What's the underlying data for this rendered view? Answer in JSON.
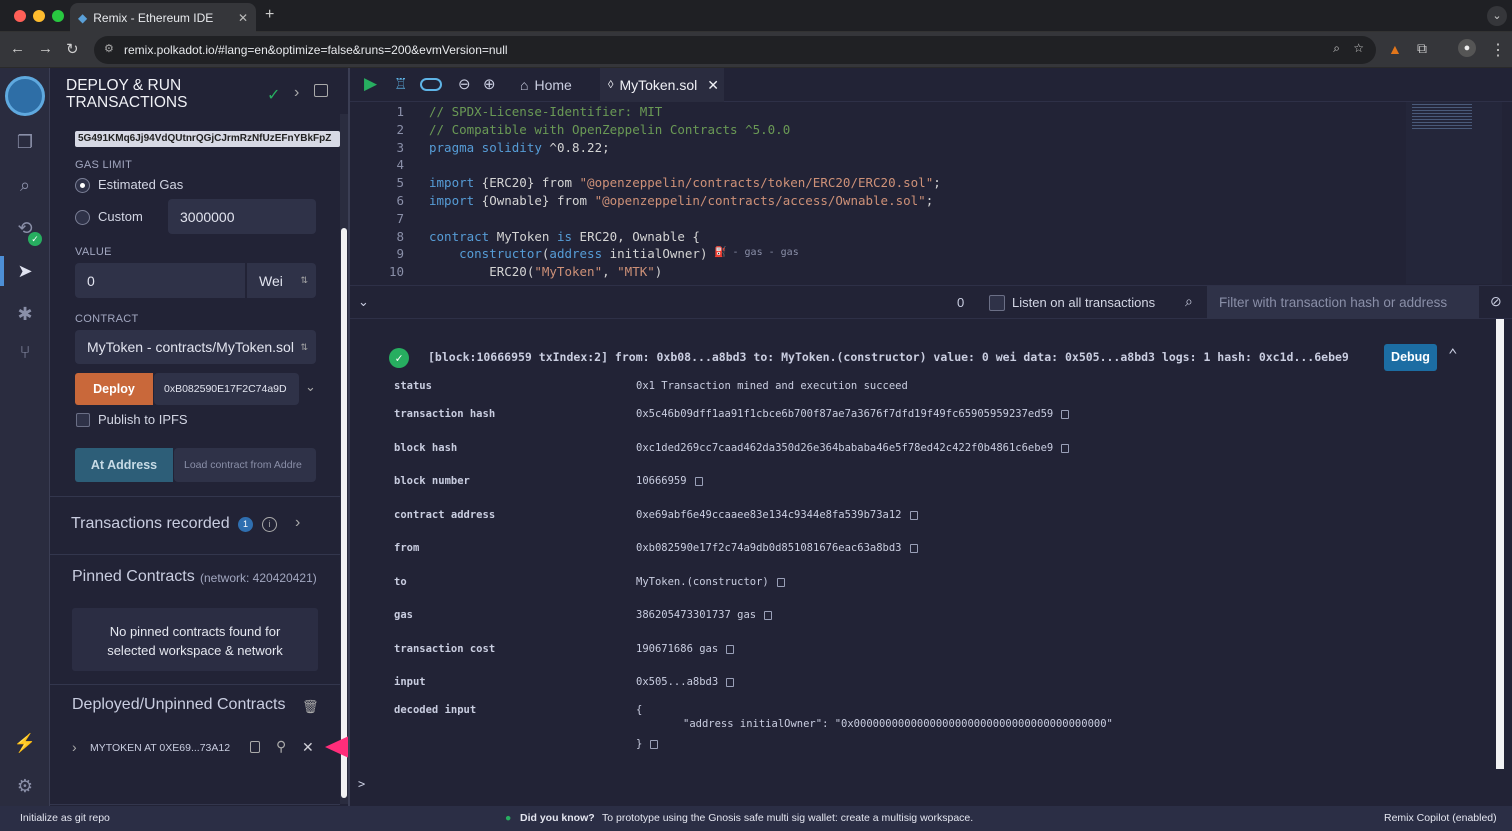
{
  "browser": {
    "tab_title": "Remix - Ethereum IDE",
    "url": "remix.polkadot.io/#lang=en&optimize=false&runs=200&evmVersion=null"
  },
  "panel": {
    "title_line1": "DEPLOY & RUN",
    "title_line2": "TRANSACTIONS",
    "account_partial": "5G491KMq6Jj94VdQUtnrQGjCJrmRzNfUzEFnYBkFpZ",
    "gas_limit_label": "GAS LIMIT",
    "estimated_gas_label": "Estimated Gas",
    "custom_label": "Custom",
    "custom_gas_value": "3000000",
    "value_label": "VALUE",
    "value_amount": "0",
    "value_unit": "Wei",
    "contract_label": "CONTRACT",
    "contract_selected": "MyToken - contracts/MyToken.sol",
    "deploy_label": "Deploy",
    "deploy_arg": "0xB082590E17F2C74a9D",
    "publish_ipfs_label": "Publish to IPFS",
    "at_address_label": "At Address",
    "at_address_placeholder": "Load contract from Addre",
    "tx_recorded_label": "Transactions recorded",
    "tx_recorded_count": "1",
    "pinned_title": "Pinned Contracts",
    "pinned_network": "(network: 420420421)",
    "pinned_empty_line1": "No pinned contracts found for",
    "pinned_empty_line2": "selected workspace & network",
    "deployed_title": "Deployed/Unpinned Contracts",
    "deployed_item": "MYTOKEN AT 0XE69...73A12"
  },
  "editor": {
    "home_tab": "Home",
    "file_tab": "MyToken.sol",
    "lines": [
      {
        "n": "1",
        "segments": [
          {
            "t": "// SPDX-License-Identifier: MIT",
            "c": "cm"
          }
        ]
      },
      {
        "n": "2",
        "segments": [
          {
            "t": "// Compatible with OpenZeppelin Contracts ^5.0.0",
            "c": "cm"
          }
        ]
      },
      {
        "n": "3",
        "segments": [
          {
            "t": "pragma solidity",
            "c": "kw"
          },
          {
            "t": " ^0.8.22;",
            "c": ""
          }
        ]
      },
      {
        "n": "4",
        "segments": []
      },
      {
        "n": "5",
        "segments": [
          {
            "t": "import",
            "c": "kw"
          },
          {
            "t": " {ERC20} from ",
            "c": ""
          },
          {
            "t": "\"@openzeppelin/contracts/token/ERC20/ERC20.sol\"",
            "c": "st"
          },
          {
            "t": ";",
            "c": ""
          }
        ]
      },
      {
        "n": "6",
        "segments": [
          {
            "t": "import",
            "c": "kw"
          },
          {
            "t": " {Ownable} from ",
            "c": ""
          },
          {
            "t": "\"@openzeppelin/contracts/access/Ownable.sol\"",
            "c": "st"
          },
          {
            "t": ";",
            "c": ""
          }
        ]
      },
      {
        "n": "7",
        "segments": []
      },
      {
        "n": "8",
        "segments": [
          {
            "t": "contract",
            "c": "kw"
          },
          {
            "t": " MyToken ",
            "c": ""
          },
          {
            "t": "is",
            "c": "kw"
          },
          {
            "t": " ERC20, Ownable {",
            "c": ""
          }
        ]
      },
      {
        "n": "9",
        "segments": [
          {
            "t": "    constructor",
            "c": "kw"
          },
          {
            "t": "(",
            "c": ""
          },
          {
            "t": "address",
            "c": "kw"
          },
          {
            "t": " initialOwner)",
            "c": ""
          }
        ]
      },
      {
        "n": "10",
        "segments": [
          {
            "t": "        ERC20(",
            "c": ""
          },
          {
            "t": "\"MyToken\"",
            "c": "st"
          },
          {
            "t": ", ",
            "c": ""
          },
          {
            "t": "\"MTK\"",
            "c": "st"
          },
          {
            "t": ")",
            "c": ""
          }
        ]
      }
    ],
    "gas_hint": "- gas - gas"
  },
  "terminal": {
    "pending_count": "0",
    "listen_label": "Listen on all transactions",
    "filter_placeholder": "Filter with transaction hash or address",
    "summary": "[block:10666959 txIndex:2] from: 0xb08...a8bd3 to: MyToken.(constructor) value: 0 wei data: 0x505...a8bd3 logs: 1 hash: 0xc1d...6ebe9",
    "debug_label": "Debug",
    "rows": [
      {
        "key": "status",
        "value": "0x1 Transaction mined and execution succeed",
        "copy": false
      },
      {
        "key": "transaction hash",
        "value": "0x5c46b09dff1aa91f1cbce6b700f87ae7a3676f7dfd19f49fc65905959237ed59",
        "copy": true
      },
      {
        "key": "block hash",
        "value": "0xc1ded269cc7caad462da350d26e364bababa46e5f78ed42c422f0b4861c6ebe9",
        "copy": true
      },
      {
        "key": "block number",
        "value": "10666959",
        "copy": true
      },
      {
        "key": "contract address",
        "value": "0xe69abf6e49ccaaee83e134c9344e8fa539b73a12",
        "copy": true
      },
      {
        "key": "from",
        "value": "0xb082590e17f2c74a9db0d851081676eac63a8bd3",
        "copy": true
      },
      {
        "key": "to",
        "value": "MyToken.(constructor)",
        "copy": true
      },
      {
        "key": "gas",
        "value": "386205473301737 gas",
        "copy": true
      },
      {
        "key": "transaction cost",
        "value": "190671686 gas",
        "copy": true
      },
      {
        "key": "input",
        "value": "0x505...a8bd3",
        "copy": true
      }
    ],
    "decoded_key": "decoded input",
    "decoded_open": "{",
    "decoded_body": "\"address initialOwner\": \"0x0000000000000000000000000000000000000000\"",
    "decoded_close": "}",
    "prompt": ">"
  },
  "statusbar": {
    "left": "Initialize as git repo",
    "tip_title": "Did you know?",
    "tip_text": "To prototype using the Gnosis safe multi sig wallet: create a multisig workspace.",
    "right": "Remix Copilot (enabled)"
  },
  "colors": {
    "deploy": "#c9683a",
    "at_address": "#2d5e78",
    "debug": "#1c6da3",
    "success": "#27ae60",
    "arrow": "#ff2d7a"
  }
}
